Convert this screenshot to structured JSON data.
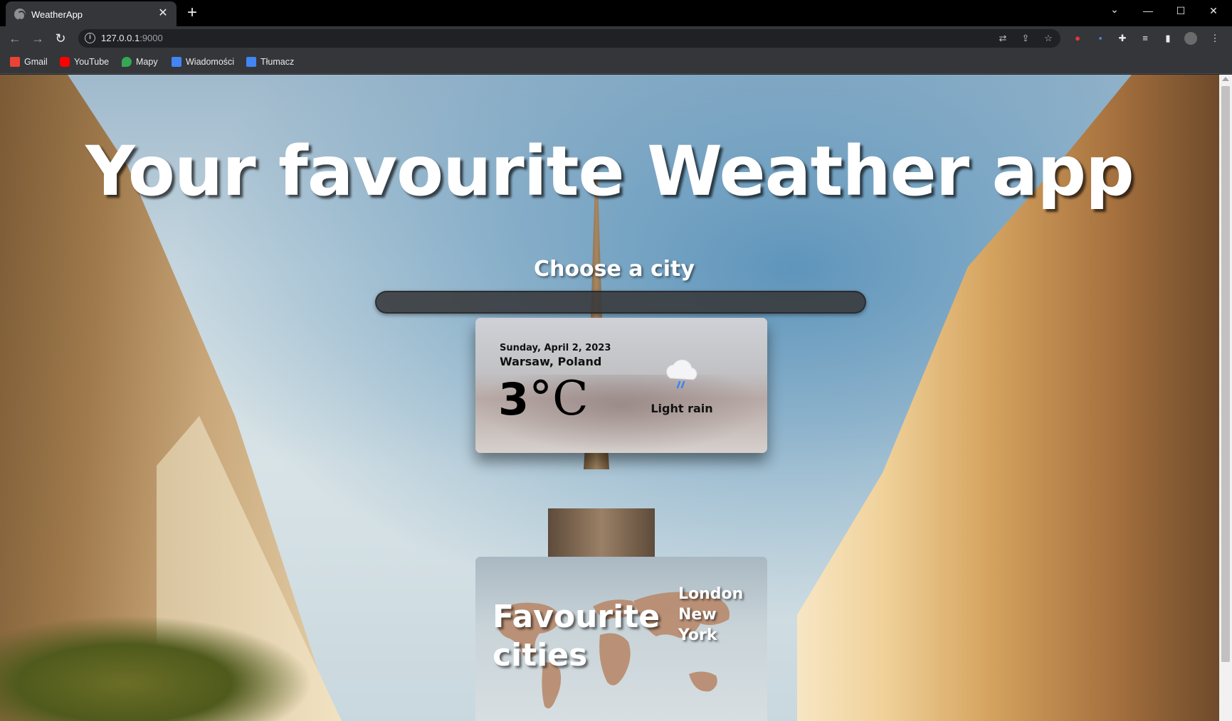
{
  "browser": {
    "tab": {
      "title": "WeatherApp",
      "close": "✕"
    },
    "new_tab": "+",
    "window_controls": {
      "tabsearch": "⌄",
      "minimize": "—",
      "maximize": "☐",
      "close": "✕"
    },
    "nav": {
      "back": "←",
      "forward": "→",
      "reload": "↻"
    },
    "address": {
      "host": "127.0.0.1",
      "port": ":9000"
    },
    "bookmarks": [
      {
        "label": "Gmail",
        "color": "#ea4335"
      },
      {
        "label": "YouTube",
        "color": "#ff0000"
      },
      {
        "label": "Mapy",
        "color": "#34a853"
      },
      {
        "label": "Wiadomości",
        "color": "#4285f4"
      },
      {
        "label": "Tłumacz",
        "color": "#4285f4"
      }
    ]
  },
  "page": {
    "title": "Your favourite Weather app",
    "choose_label": "Choose a city",
    "search_placeholder": "",
    "weather": {
      "date": "Sunday, April 2, 2023",
      "city": "Warsaw, Poland",
      "temp_value": "3",
      "temp_unit": "°C",
      "description": "Light rain",
      "icon": "light-rain-icon"
    },
    "favourites": {
      "title_line1": "Favourite",
      "title_line2": "cities",
      "cities": [
        "London",
        "New",
        "York"
      ]
    }
  },
  "colors": {
    "browser_bg": "#35363a",
    "tab_strip": "#000000",
    "card_text": "#111111",
    "rain_drops": "#3b82f6"
  }
}
